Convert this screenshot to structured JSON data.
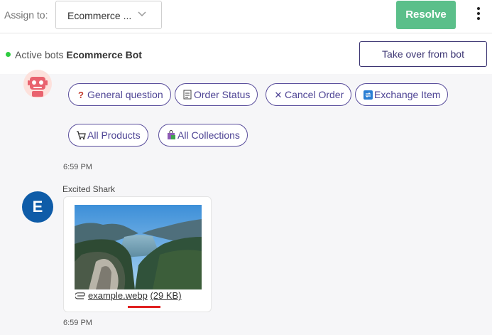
{
  "header": {
    "assign_label": "Assign to:",
    "assign_value": "Ecommerce ...",
    "resolve_label": "Resolve"
  },
  "bot_status": {
    "prefix": "Active bots",
    "bot_name": "Ecommerce Bot",
    "takeover_label": "Take over from bot"
  },
  "quick_replies": [
    {
      "icon": "question-icon",
      "label": "General question"
    },
    {
      "icon": "document-icon",
      "label": "Order Status"
    },
    {
      "icon": "close-icon",
      "label": "Cancel Order"
    },
    {
      "icon": "exchange-icon",
      "label": "Exchange Item"
    },
    {
      "icon": "cart-icon",
      "label": "All Products"
    },
    {
      "icon": "shopping-bag-icon",
      "label": "All Collections"
    }
  ],
  "bot_message_time": "6:59 PM",
  "user_message": {
    "avatar_letter": "E",
    "sender": "Excited Shark",
    "attachment_name": "example.webp",
    "attachment_size": "(29 KB)",
    "time": "6:59 PM"
  },
  "colors": {
    "resolve": "#5bbf8a",
    "accent": "#4d4394",
    "avatar": "#0f5ca8",
    "status_dot": "#2ecc40"
  }
}
